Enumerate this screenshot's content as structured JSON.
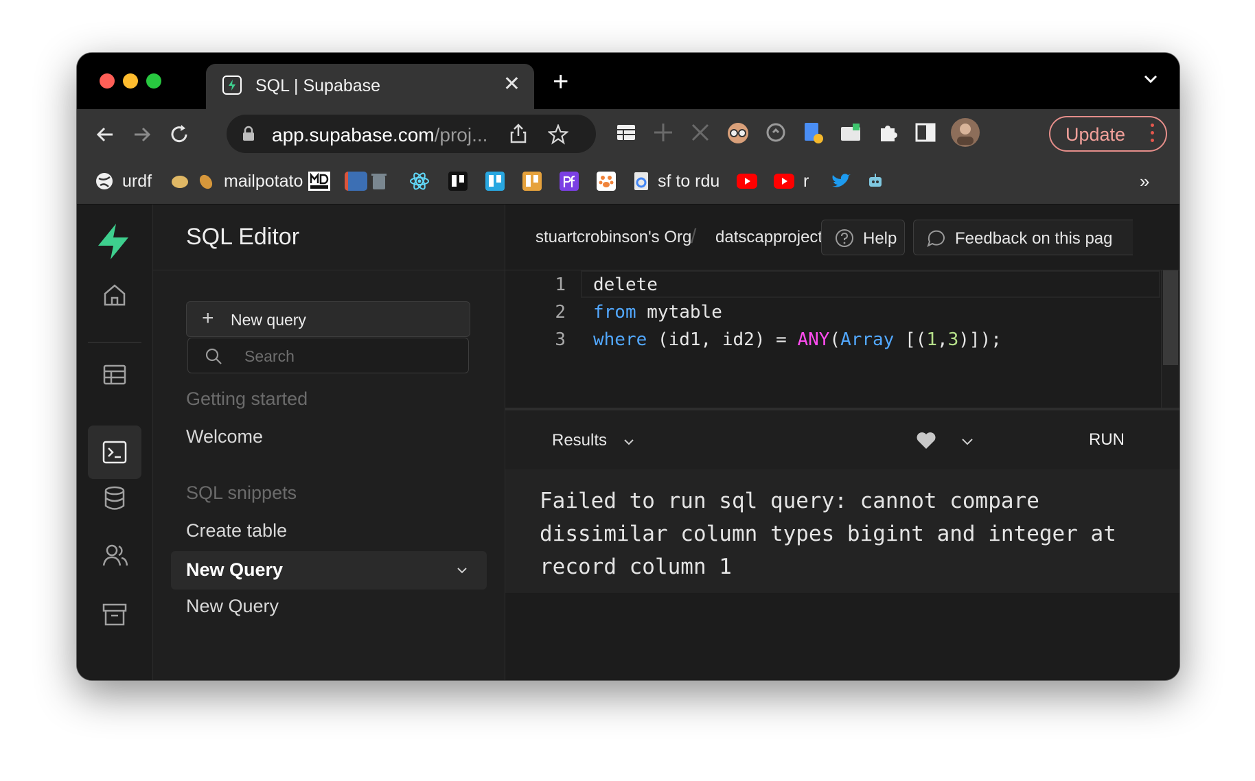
{
  "browser": {
    "tab_title": "SQL | Supabase",
    "url_domain": "app.supabase.com",
    "url_path": "/proj...",
    "update_label": "Update",
    "bookmarks": [
      "urdf",
      "mailpotato",
      "sf to rdu",
      "r"
    ],
    "bookmarks_overflow": "»"
  },
  "sidebar": {
    "title": "SQL Editor",
    "new_query_label": "New query",
    "search_placeholder": "Search",
    "sections": [
      {
        "label": "Getting started",
        "items": [
          "Welcome"
        ]
      },
      {
        "label": "SQL snippets",
        "items": [
          "Create table",
          "New Query",
          "New Query"
        ]
      }
    ]
  },
  "header": {
    "org": "stuartcrobinson's Org",
    "separator": "/",
    "project": "datscapproject",
    "help_label": "Help",
    "feedback_label": "Feedback on this pag"
  },
  "editor": {
    "line_numbers": [
      "1",
      "2",
      "3"
    ],
    "line1": {
      "text": "delete"
    },
    "line2": {
      "kw": "from",
      "rest": " mytable"
    },
    "line3": {
      "kw": "where",
      "a": " (id1, id2) = ",
      "fn": "ANY",
      "b": "(",
      "kw2": "Array",
      "c": " [(",
      "n1": "1",
      "d": ",",
      "n2": "3",
      "e": ")]);"
    }
  },
  "results": {
    "tab_label": "Results",
    "run_label": "RUN",
    "error_message": "Failed to run sql query: cannot compare dissimilar column types bigint and integer at record column 1"
  },
  "colors": {
    "brand": "#3ecf8e",
    "keyword": "#52a8ff",
    "function": "#ff4cf0",
    "number": "#b6e08a",
    "update": "#f2a09a"
  }
}
